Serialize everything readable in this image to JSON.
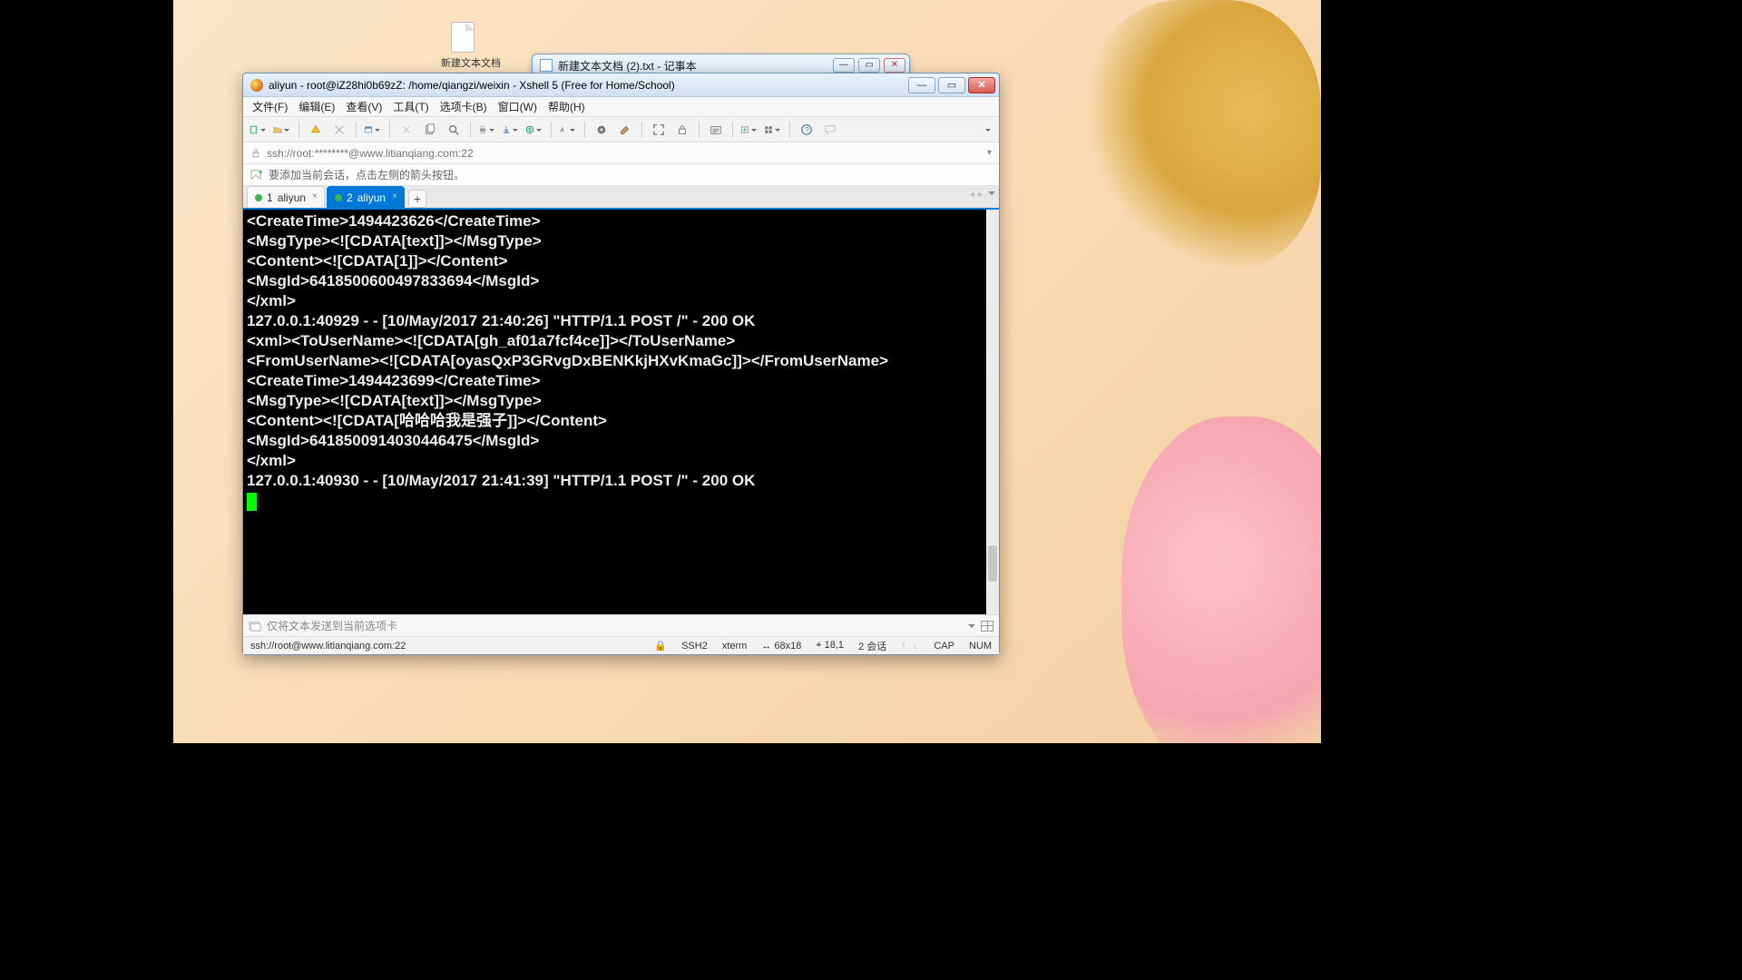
{
  "desktop": {
    "file_label": "新建文本文档"
  },
  "notepad": {
    "title": "新建文本文档 (2).txt - 记事本"
  },
  "window": {
    "title": "aliyun - root@iZ28hi0b69zZ: /home/qiangzi/weixin - Xshell 5 (Free for Home/School)"
  },
  "menubar": {
    "file": "文件(F)",
    "edit": "编辑(E)",
    "view": "查看(V)",
    "tools": "工具(T)",
    "tabs": "选项卡(B)",
    "window": "窗口(W)",
    "help": "帮助(H)"
  },
  "address": {
    "url": "ssh://root:********@www.litianqiang.com:22"
  },
  "hint": {
    "text": "要添加当前会话，点击左侧的箭头按钮。"
  },
  "tabs": {
    "items": [
      {
        "index": "1",
        "label": "aliyun"
      },
      {
        "index": "2",
        "label": "aliyun"
      }
    ],
    "add": "+"
  },
  "terminal": {
    "content": "<CreateTime>1494423626</CreateTime>\n<MsgType><![CDATA[text]]></MsgType>\n<Content><![CDATA[1]]></Content>\n<MsgId>6418500600497833694</MsgId>\n</xml>\n127.0.0.1:40929 - - [10/May/2017 21:40:26] \"HTTP/1.1 POST /\" - 200 OK\n<xml><ToUserName><![CDATA[gh_af01a7fcf4ce]]></ToUserName>\n<FromUserName><![CDATA[oyasQxP3GRvgDxBENKkjHXvKmaGc]]></FromUserName>\n<CreateTime>1494423699</CreateTime>\n<MsgType><![CDATA[text]]></MsgType>\n<Content><![CDATA[哈哈哈我是强子]]></Content>\n<MsgId>6418500914030446475</MsgId>\n</xml>\n127.0.0.1:40930 - - [10/May/2017 21:41:39] \"HTTP/1.1 POST /\" - 200 OK"
  },
  "sendbar": {
    "placeholder": "仅将文本发送到当前选项卡"
  },
  "status": {
    "path": "ssh://root@www.litianqiang.com:22",
    "proto": "SSH2",
    "term": "xterm",
    "size": "68x18",
    "pos": "18,1",
    "sessions": "2 会话",
    "caps": "CAP",
    "num": "NUM"
  }
}
